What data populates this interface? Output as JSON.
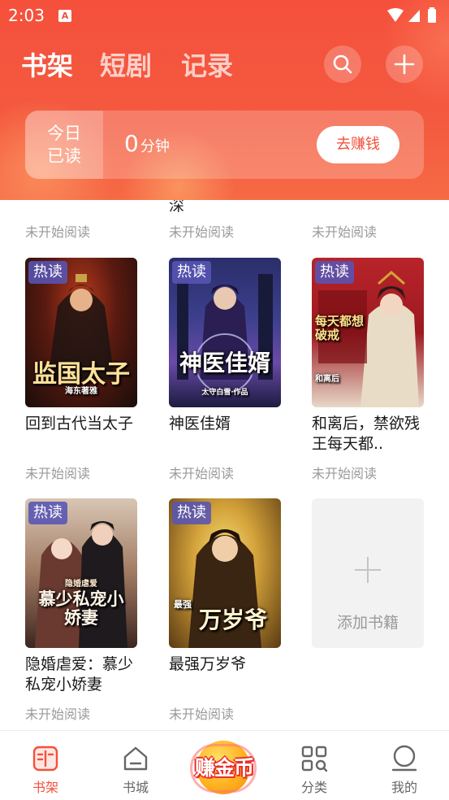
{
  "status_bar": {
    "time": "2:03",
    "notification_icon": "A"
  },
  "header": {
    "tabs": [
      {
        "label": "书架",
        "active": true
      },
      {
        "label": "短剧",
        "active": false
      },
      {
        "label": "记录",
        "active": false
      }
    ],
    "search_icon": "search-icon",
    "add_icon": "plus-icon",
    "today_read": {
      "label_line1": "今日",
      "label_line2": "已读",
      "minutes": "0",
      "unit": "分钟",
      "earn_button": "去赚钱"
    }
  },
  "partial_row": {
    "partial_title_tail": "深",
    "statuses": [
      "未开始阅读",
      "未开始阅读",
      "未开始阅读"
    ]
  },
  "books": [
    {
      "title": "回到古代当太子",
      "status": "未开始阅读",
      "tag": "热读",
      "cover_text": "监国太子",
      "cover_author": "海东著雅"
    },
    {
      "title": "神医佳婿",
      "status": "未开始阅读",
      "tag": "热读",
      "cover_text": "神医佳婿",
      "cover_author": "太守白雪·作品"
    },
    {
      "title": "和离后，禁欲残王每天都..",
      "status": "未开始阅读",
      "tag": "热读",
      "cover_text": "每天都想破戒",
      "cover_author": "和离后"
    },
    {
      "title": "隐婚虐爱：慕少私宠小娇妻",
      "status": "未开始阅读",
      "tag": "热读",
      "cover_text": "慕少私宠小娇妻",
      "cover_author": "隐婚虐爱"
    },
    {
      "title": "最强万岁爷",
      "status": "未开始阅读",
      "tag": "热读",
      "cover_text": "万岁爷",
      "cover_author": "最强"
    }
  ],
  "add_book": {
    "label": "添加书籍"
  },
  "bottom_nav": {
    "items": [
      {
        "label": "书架",
        "icon": "bookshelf-icon",
        "active": true
      },
      {
        "label": "书城",
        "icon": "store-icon",
        "active": false
      },
      {
        "label": "分类",
        "icon": "category-icon",
        "active": false
      },
      {
        "label": "我的",
        "icon": "profile-icon",
        "active": false
      }
    ],
    "center_badge": "赚金币"
  },
  "colors": {
    "accent": "#f4513c",
    "tag_bg": "#5854b4",
    "muted_text": "#9a9a9a"
  }
}
